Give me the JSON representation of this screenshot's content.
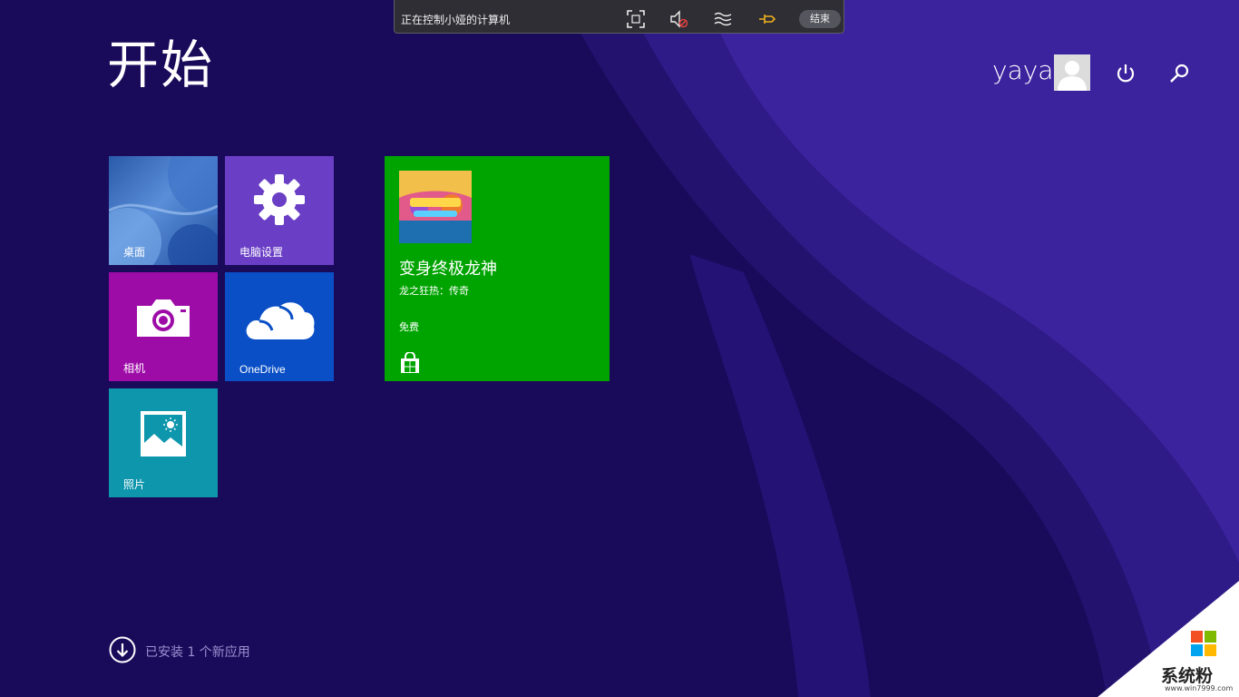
{
  "remote_bar": {
    "title": "正在控制小娅的计算机",
    "icons": [
      "fullscreen-icon",
      "mute-icon",
      "quality-icon",
      "pin-icon"
    ],
    "end_label": "结束"
  },
  "start": {
    "title": "开始"
  },
  "user": {
    "name": "yaya"
  },
  "tiles": {
    "desktop": "桌面",
    "settings": "电脑设置",
    "camera": "相机",
    "onedrive": "OneDrive",
    "photos": "照片"
  },
  "store_tile": {
    "title": "变身终极龙神",
    "subtitle": "龙之狂热：传奇",
    "price": "免费"
  },
  "install_note": "已安装 1 个新应用",
  "watermark": {
    "brand": "系统粉",
    "site": "www.win7999.com"
  },
  "colors": {
    "background": "#1a0a5a",
    "tile_settings": "#6a3fc6",
    "tile_camera": "#9e0ca8",
    "tile_onedrive": "#0a4fc6",
    "tile_photos": "#0e96ac",
    "tile_store": "#00a400"
  }
}
